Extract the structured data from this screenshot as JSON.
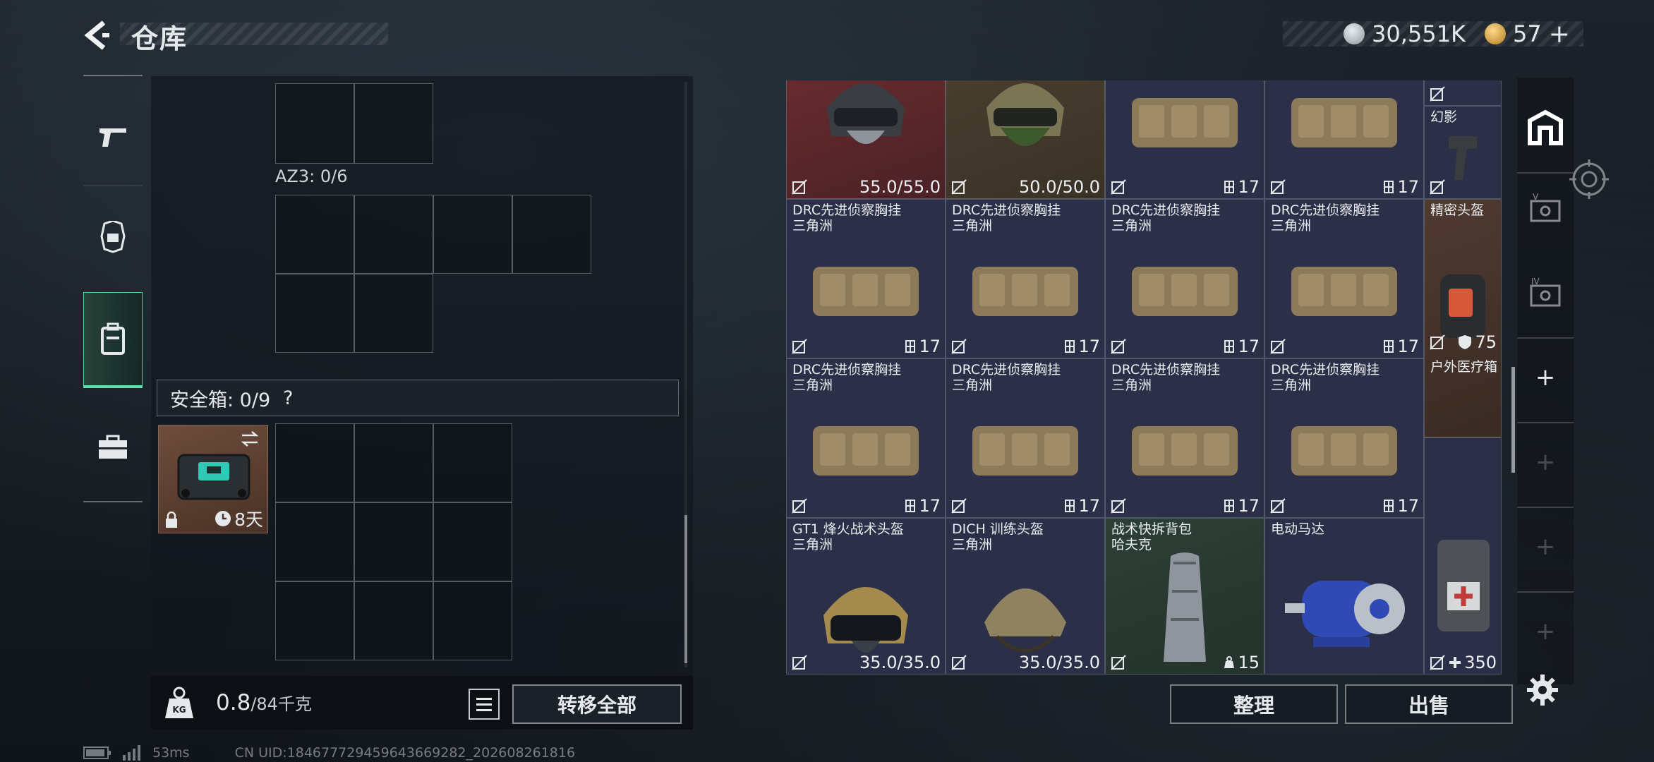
{
  "header": {
    "title": "仓库",
    "currency_1": "30,551K",
    "currency_2": "57",
    "add_symbol": "+"
  },
  "left_nav": {
    "items": [
      {
        "name": "weapon",
        "icon": "pistol-icon"
      },
      {
        "name": "helmet",
        "icon": "helmet-icon"
      },
      {
        "name": "backpack",
        "icon": "backpack-icon",
        "active": true
      },
      {
        "name": "briefcase",
        "icon": "briefcase-icon"
      }
    ]
  },
  "loadout": {
    "az3_label": "AZ3: 0/6",
    "safebox_label": "安全箱: 0/9",
    "safebox_help": "?",
    "safebox_item_timer": "8天",
    "weight_value": "0.8",
    "weight_max": "/84千克",
    "transfer_all": "转移全部"
  },
  "stash": {
    "items": [
      {
        "id": "r1c1",
        "name1": "",
        "name2": "",
        "value": "55.0/55.0",
        "kind": "durability"
      },
      {
        "id": "r1c2",
        "name1": "",
        "name2": "",
        "value": "50.0/50.0",
        "kind": "durability"
      },
      {
        "id": "r1c3",
        "name1": "",
        "name2": "",
        "value": "17",
        "kind": "slots"
      },
      {
        "id": "r1c4",
        "name1": "",
        "name2": "",
        "value": "17",
        "kind": "slots"
      },
      {
        "id": "r1c5a",
        "name1": "",
        "name2": "",
        "value": "",
        "kind": "none"
      },
      {
        "id": "r1c5b",
        "name1": "幻影",
        "name2": "",
        "value": "",
        "kind": "none"
      },
      {
        "id": "r2c1",
        "name1": "DRC先进侦察胸挂",
        "name2": "三角洲",
        "value": "17",
        "kind": "slots"
      },
      {
        "id": "r2c2",
        "name1": "DRC先进侦察胸挂",
        "name2": "三角洲",
        "value": "17",
        "kind": "slots"
      },
      {
        "id": "r2c3",
        "name1": "DRC先进侦察胸挂",
        "name2": "三角洲",
        "value": "17",
        "kind": "slots"
      },
      {
        "id": "r2c4",
        "name1": "DRC先进侦察胸挂",
        "name2": "三角洲",
        "value": "17",
        "kind": "slots"
      },
      {
        "id": "r2c5",
        "name1": "精密头盔",
        "name2": "",
        "value": "75",
        "kind": "armor"
      },
      {
        "id": "r3c1",
        "name1": "DRC先进侦察胸挂",
        "name2": "三角洲",
        "value": "17",
        "kind": "slots"
      },
      {
        "id": "r3c2",
        "name1": "DRC先进侦察胸挂",
        "name2": "三角洲",
        "value": "17",
        "kind": "slots"
      },
      {
        "id": "r3c3",
        "name1": "DRC先进侦察胸挂",
        "name2": "三角洲",
        "value": "17",
        "kind": "slots"
      },
      {
        "id": "r3c4",
        "name1": "DRC先进侦察胸挂",
        "name2": "三角洲",
        "value": "17",
        "kind": "slots"
      },
      {
        "id": "r4c1",
        "name1": "GT1 烽火战术头盔",
        "name2": "三角洲",
        "value": "35.0/35.0",
        "kind": "durability"
      },
      {
        "id": "r4c2",
        "name1": "DICH 训练头盔",
        "name2": "三角洲",
        "value": "35.0/35.0",
        "kind": "durability"
      },
      {
        "id": "r4c3",
        "name1": "战术快拆背包",
        "name2": "哈夫克",
        "value": "15",
        "kind": "weight"
      },
      {
        "id": "r4c4",
        "name1": "电动马达",
        "name2": "",
        "value": "",
        "kind": "none"
      },
      {
        "id": "r3c5",
        "name1": "户外医疗箱",
        "name2": "",
        "value": "350",
        "kind": "heal"
      }
    ]
  },
  "actions": {
    "sort": "整理",
    "sell": "出售"
  },
  "right_rail": {
    "items": [
      "stash-main-icon",
      "case-v-icon",
      "case-iv-icon",
      "add-slot-icon",
      "add-slot-icon",
      "add-slot-icon",
      "add-slot-icon"
    ],
    "plus": "+"
  },
  "status": {
    "ping": "53ms",
    "uid": "CN UID:18467772945964366928​2_202608261816"
  },
  "colors": {
    "accent": "#5de0b0",
    "item_blue": "#2b2f47",
    "item_red": "#6b2c30",
    "item_brown": "#4f3a30"
  }
}
